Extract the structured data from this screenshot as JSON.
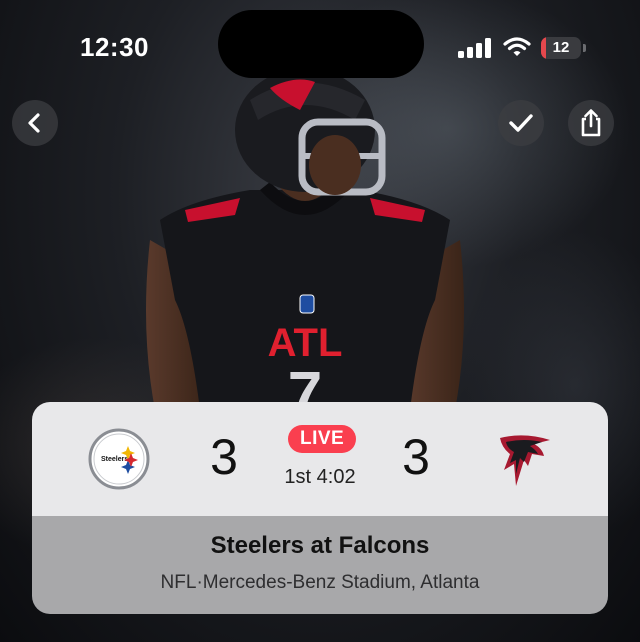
{
  "status_bar": {
    "time": "12:30",
    "battery_level": "12",
    "battery_color": "#e5484d",
    "icons": [
      "cellular-signal-icon",
      "wifi-icon",
      "battery-icon"
    ]
  },
  "top_controls": {
    "back": {
      "icon": "chevron-left-icon",
      "label": "Back"
    },
    "done": {
      "icon": "checkmark-icon",
      "label": "Done"
    },
    "share": {
      "icon": "share-icon",
      "label": "Share"
    }
  },
  "hero": {
    "jersey_text": "ATL",
    "jersey_number": "7"
  },
  "scoreboard": {
    "home_team_logo": "steelers-logo",
    "away_team_logo": "falcons-logo",
    "home_score": "3",
    "away_score": "3",
    "live_label": "LIVE",
    "live_color": "#fa3f4f",
    "clock": "1st 4:02"
  },
  "game_info": {
    "matchup": "Steelers at Falcons",
    "league": "NFL",
    "separator": "·",
    "venue": "Mercedes-Benz Stadium, Atlanta"
  }
}
